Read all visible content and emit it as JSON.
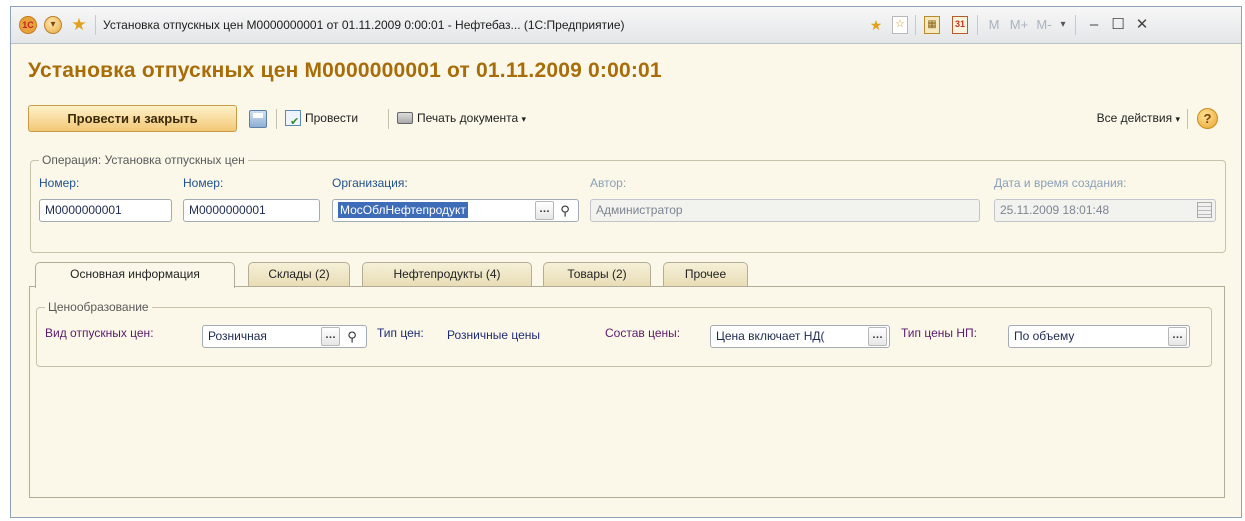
{
  "window": {
    "title": "Установка отпускных цен M0000000001 от 01.11.2009 0:00:01 - Нефтебаз... (1С:Предприятие)",
    "icons": [
      "1c-logo-icon",
      "circle-menu-icon",
      "favorite-star-icon",
      "add-favorite-icon",
      "bookmark-icon",
      "calculator-icon",
      "calendar-icon"
    ],
    "memory_buttons": [
      "M",
      "M+",
      "M-"
    ]
  },
  "form": {
    "title": "Установка отпускных цен M0000000001 от 01.11.2009 0:00:01"
  },
  "toolbar": {
    "post_and_close": "Провести и закрыть",
    "post": "Провести",
    "print": "Печать документа",
    "all_actions": "Все действия",
    "help": "?"
  },
  "header_group": {
    "legend": "Операция: Установка отпускных цен",
    "number1_label": "Номер:",
    "number1_value": "M0000000001",
    "number2_label": "Номер:",
    "number2_value": "M0000000001",
    "org_label": "Организация:",
    "org_value": "МосОблНефтепродукт",
    "author_label": "Автор:",
    "author_value": "Администратор",
    "created_label": "Дата и время создания:",
    "created_value": "25.11.2009 18:01:48"
  },
  "tabs": [
    {
      "label": "Основная информация",
      "active": true
    },
    {
      "label": "Склады (2)",
      "active": false
    },
    {
      "label": "Нефтепродукты (4)",
      "active": false
    },
    {
      "label": "Товары (2)",
      "active": false
    },
    {
      "label": "Прочее",
      "active": false
    }
  ],
  "pricing_group": {
    "legend": "Ценообразование",
    "price_kind_label": "Вид отпускных цен:",
    "price_kind_value": "Розничная",
    "price_type_label": "Тип цен:",
    "price_type_value": "Розничные цены",
    "composition_label": "Состав цены:",
    "composition_value": "Цена включает НД(",
    "np_type_label": "Тип цены НП:",
    "np_type_value": "По объему"
  }
}
